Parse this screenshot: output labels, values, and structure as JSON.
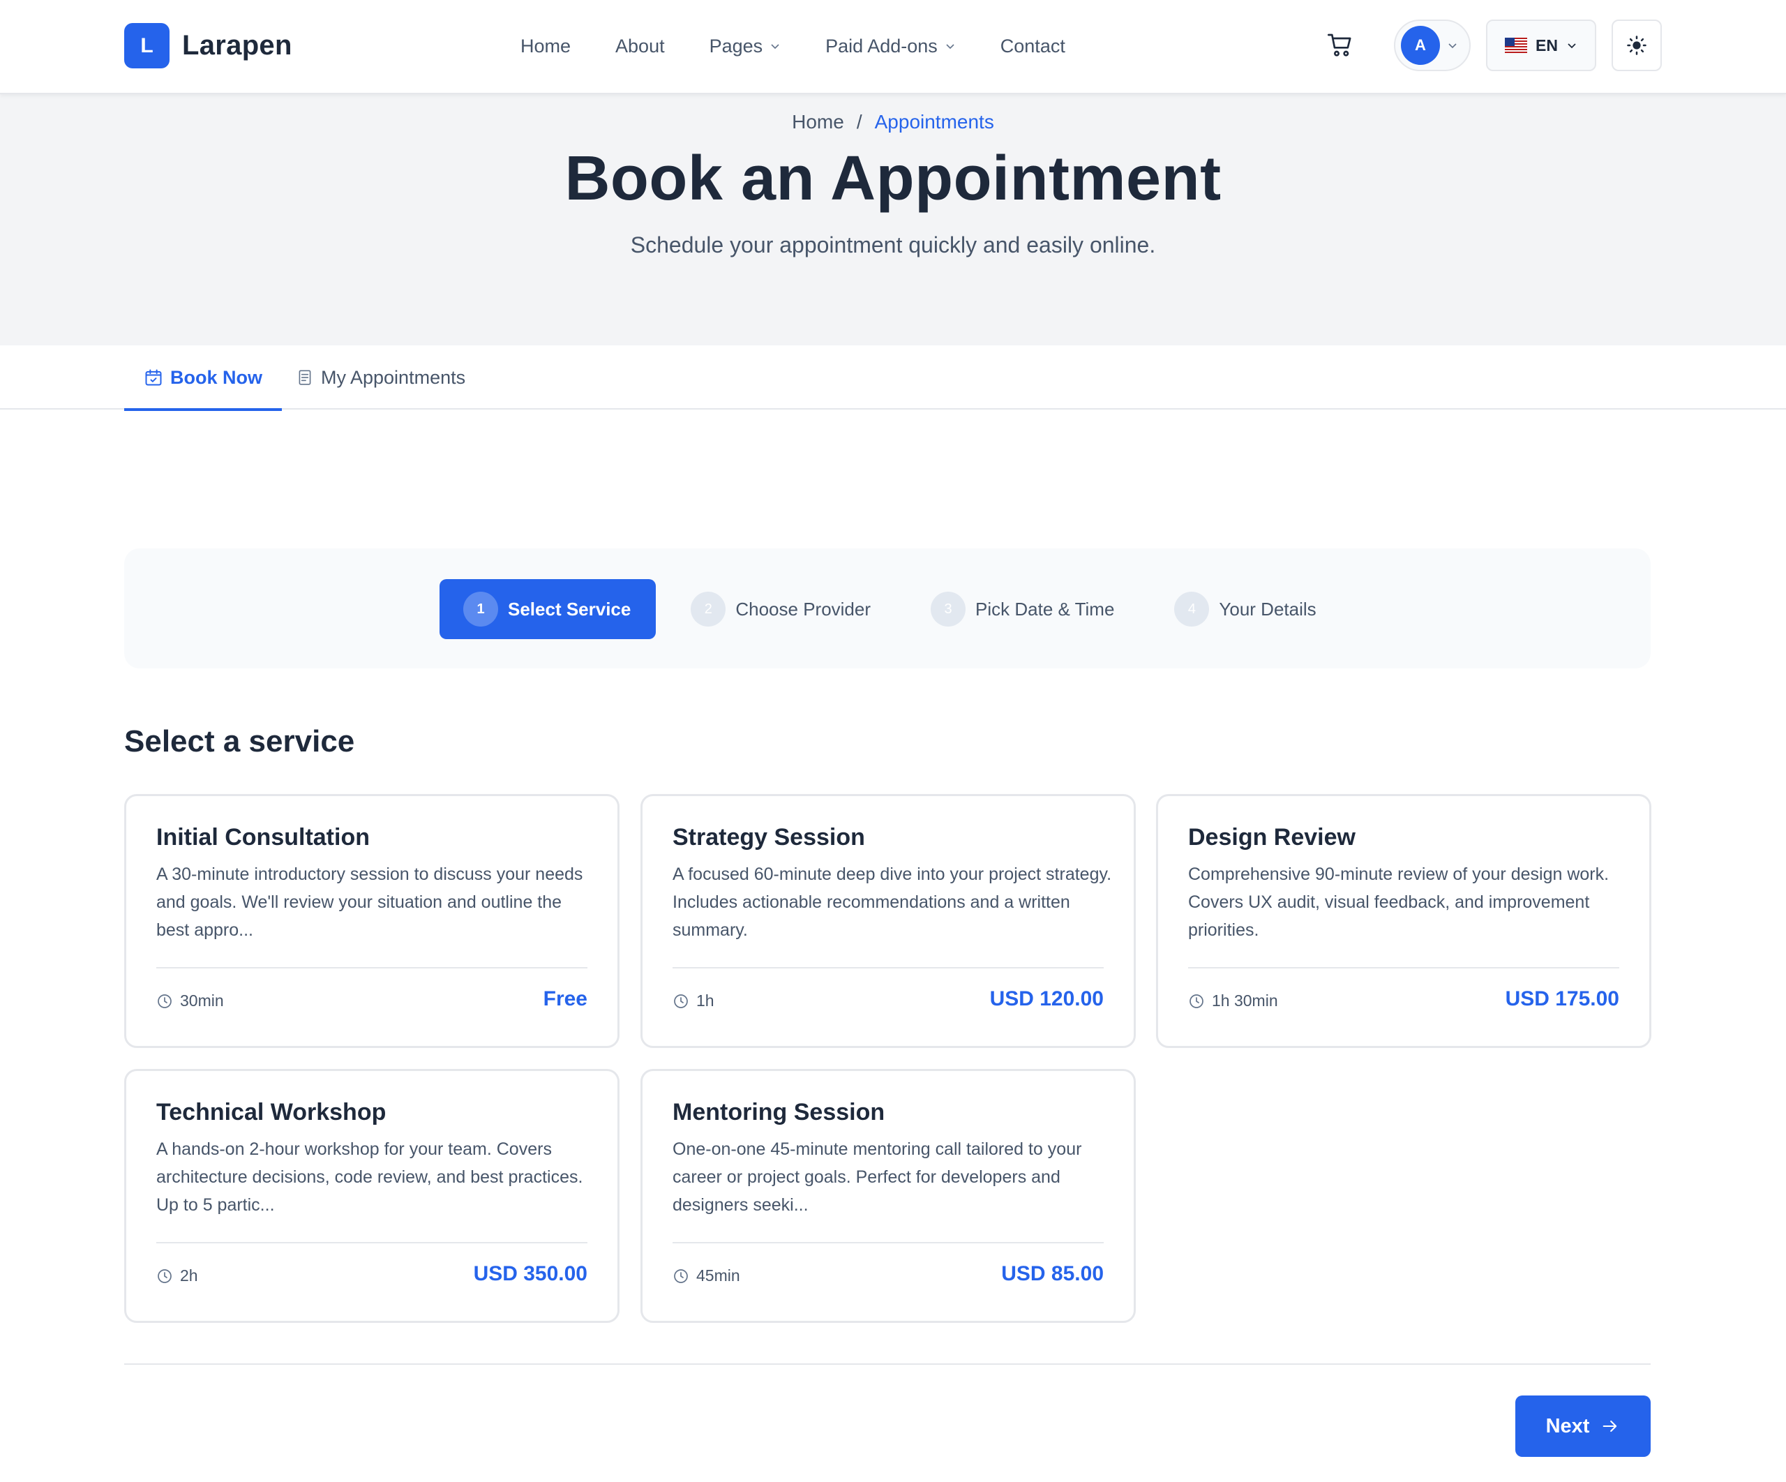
{
  "brand": {
    "mark": "L",
    "name": "Larapen"
  },
  "nav": {
    "links": [
      {
        "label": "Home"
      },
      {
        "label": "About"
      },
      {
        "label": "Pages"
      },
      {
        "label": "Paid Add-ons"
      },
      {
        "label": "Contact"
      }
    ],
    "user_initial": "A",
    "language": "EN"
  },
  "hero": {
    "breadcrumb": {
      "home": "Home",
      "separator": "/",
      "current": "Appointments"
    },
    "title": "Book an Appointment",
    "subtitle": "Schedule your appointment quickly and easily online."
  },
  "tabs": [
    {
      "label": "Book Now",
      "active": true
    },
    {
      "label": "My Appointments",
      "active": false
    }
  ],
  "stepper": {
    "steps": [
      {
        "number": "1",
        "label": "Select Service",
        "active": true
      },
      {
        "number": "2",
        "label": "Choose Provider",
        "active": false
      },
      {
        "number": "3",
        "label": "Pick Date & Time",
        "active": false
      },
      {
        "number": "4",
        "label": "Your Details",
        "active": false
      }
    ]
  },
  "services": {
    "heading": "Select a service",
    "items": [
      {
        "title": "Initial Consultation",
        "description": "A 30-minute introductory session to discuss your needs and goals. We'll review your situation and outline the best appro...",
        "duration": "30min",
        "price": "Free"
      },
      {
        "title": "Strategy Session",
        "description": "A focused 60-minute deep dive into your project strategy. Includes actionable recommendations and a written summary.",
        "duration": "1h",
        "price": "USD 120.00"
      },
      {
        "title": "Design Review",
        "description": "Comprehensive 90-minute review of your design work. Covers UX audit, visual feedback, and improvement priorities.",
        "duration": "1h 30min",
        "price": "USD 175.00"
      },
      {
        "title": "Technical Workshop",
        "description": "A hands-on 2-hour workshop for your team. Covers architecture decisions, code review, and best practices. Up to 5 partic...",
        "duration": "2h",
        "price": "USD 350.00"
      },
      {
        "title": "Mentoring Session",
        "description": "One-on-one 45-minute mentoring call tailored to your career or project goals. Perfect for developers and designers seeki...",
        "duration": "45min",
        "price": "USD 85.00"
      }
    ]
  },
  "actions": {
    "next_label": "Next"
  },
  "colors": {
    "accent": "#2563eb",
    "text": "#1e293b",
    "muted": "#475569",
    "border": "#e5e7eb",
    "hero_bg": "#f3f4f6"
  },
  "icons": [
    "cart-icon",
    "chevron-down-icon",
    "us-flag-icon",
    "sun-icon",
    "calendar-check-icon",
    "document-list-icon",
    "clock-icon",
    "arrow-right-icon"
  ]
}
